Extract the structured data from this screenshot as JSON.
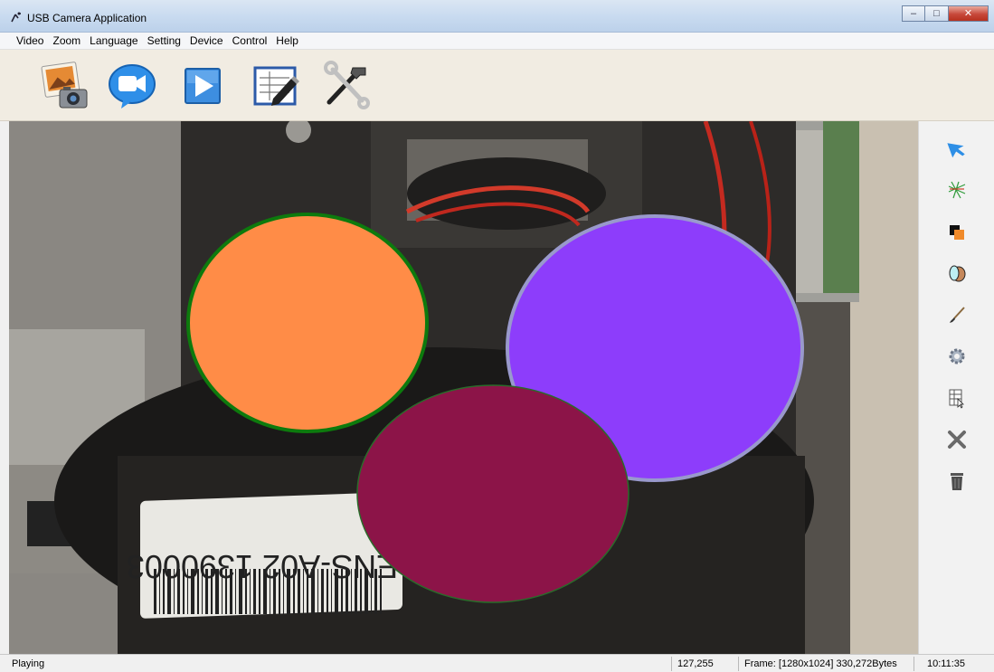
{
  "window": {
    "title": "USB Camera Application"
  },
  "window_controls": {
    "minimize": "–",
    "maximize": "□",
    "close": "✕"
  },
  "menu": [
    {
      "id": "video",
      "label": "Video"
    },
    {
      "id": "zoom",
      "label": "Zoom"
    },
    {
      "id": "language",
      "label": "Language"
    },
    {
      "id": "setting",
      "label": "Setting"
    },
    {
      "id": "device",
      "label": "Device"
    },
    {
      "id": "control",
      "label": "Control"
    },
    {
      "id": "help",
      "label": "Help"
    }
  ],
  "toolbar": [
    {
      "name": "snapshot-button",
      "icon": "camera-photo-icon"
    },
    {
      "name": "record-video-button",
      "icon": "video-camera-icon"
    },
    {
      "name": "play-button",
      "icon": "play-icon"
    },
    {
      "name": "edit-annotation-button",
      "icon": "pencil-sheet-icon"
    },
    {
      "name": "tools-settings-button",
      "icon": "hammer-wrench-icon"
    }
  ],
  "viewport": {
    "label_text": "LENS-A02 1390003",
    "overlay_shapes": [
      {
        "name": "orange-ellipse",
        "fill": "#ff8c47",
        "stroke": "#0d7a0d"
      },
      {
        "name": "purple-ellipse",
        "fill": "#8d3dfb",
        "stroke": "#9999cc"
      },
      {
        "name": "maroon-ellipse",
        "fill": "#8c1448",
        "stroke": "#2a6b2a"
      }
    ]
  },
  "side_tools": [
    {
      "name": "select-arrow-tool",
      "icon": "arrow-pointer-icon"
    },
    {
      "name": "measure-lines-tool",
      "icon": "crossed-lines-icon"
    },
    {
      "name": "layer-order-tool",
      "icon": "overlap-squares-icon"
    },
    {
      "name": "fill-color-tool",
      "icon": "color-blob-icon"
    },
    {
      "name": "brush-tool",
      "icon": "brush-icon"
    },
    {
      "name": "settings-tool",
      "icon": "gear-icon"
    },
    {
      "name": "properties-tool",
      "icon": "table-cursor-icon"
    },
    {
      "name": "delete-tool",
      "icon": "x-mark-icon"
    },
    {
      "name": "trash-tool",
      "icon": "trash-can-icon"
    }
  ],
  "status": {
    "state": "Playing",
    "cursor": "127,255",
    "frame": "Frame: [1280x1024] 330,272Bytes",
    "time": "10:11:35"
  }
}
